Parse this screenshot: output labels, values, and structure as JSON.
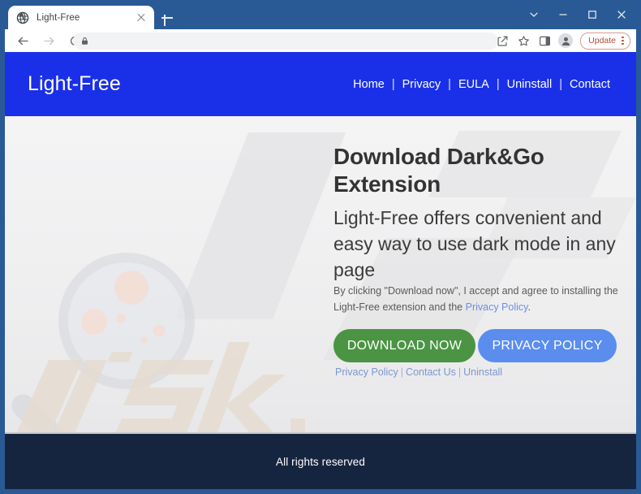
{
  "browser": {
    "tab": {
      "title": "Light-Free",
      "favicon_icon": "globe-icon",
      "close_icon": "close-icon"
    },
    "new_tab_icon": "plus-icon",
    "window_controls": {
      "minimize_chevron_icon": "chevron-down-icon",
      "minimize_icon": "minimize-icon",
      "maximize_icon": "maximize-icon",
      "close_icon": "close-icon"
    },
    "toolbar": {
      "back_icon": "back-arrow-icon",
      "forward_icon": "forward-arrow-icon",
      "reload_icon": "reload-icon",
      "lock_icon": "lock-icon",
      "url": "",
      "url_placeholder": "",
      "share_icon": "share-icon",
      "bookmark_icon": "star-icon",
      "sidepanel_icon": "side-panel-icon",
      "profile_icon": "profile-avatar-icon",
      "update_label": "Update",
      "menu_icon": "kebab-menu-icon"
    }
  },
  "site": {
    "header": {
      "brand": "Light-Free",
      "nav": [
        {
          "label": "Home"
        },
        {
          "label": "Privacy"
        },
        {
          "label": "EULA"
        },
        {
          "label": "Uninstall"
        },
        {
          "label": "Contact"
        }
      ],
      "separator": "|"
    },
    "hero": {
      "title": "Download Dark&Go Extension",
      "subtitle": "Light-Free offers convenient and easy way to use dark mode in any page",
      "disclaimer_prefix": "By clicking \"Download now\", I accept and agree to installing the Light-Free extension and the ",
      "disclaimer_link": "Privacy Policy",
      "disclaimer_suffix": ".",
      "download_button": "DOWNLOAD NOW",
      "privacy_button": "PRIVACY POLICY",
      "bottom_links": [
        {
          "label": "Privacy Policy"
        },
        {
          "label": "Contact Us"
        },
        {
          "label": "Uninstall"
        }
      ],
      "link_separator": "|",
      "watermark_text": "risk"
    },
    "footer": {
      "text": "All rights reserved"
    }
  },
  "colors": {
    "header_blue": "#1a30e8",
    "footer_navy": "#16253f",
    "download_green": "#4a9443",
    "privacy_blue": "#5b8def",
    "window_border": "#2a5a96",
    "link_blue": "#6c8fe0",
    "update_red": "#b24a37"
  }
}
